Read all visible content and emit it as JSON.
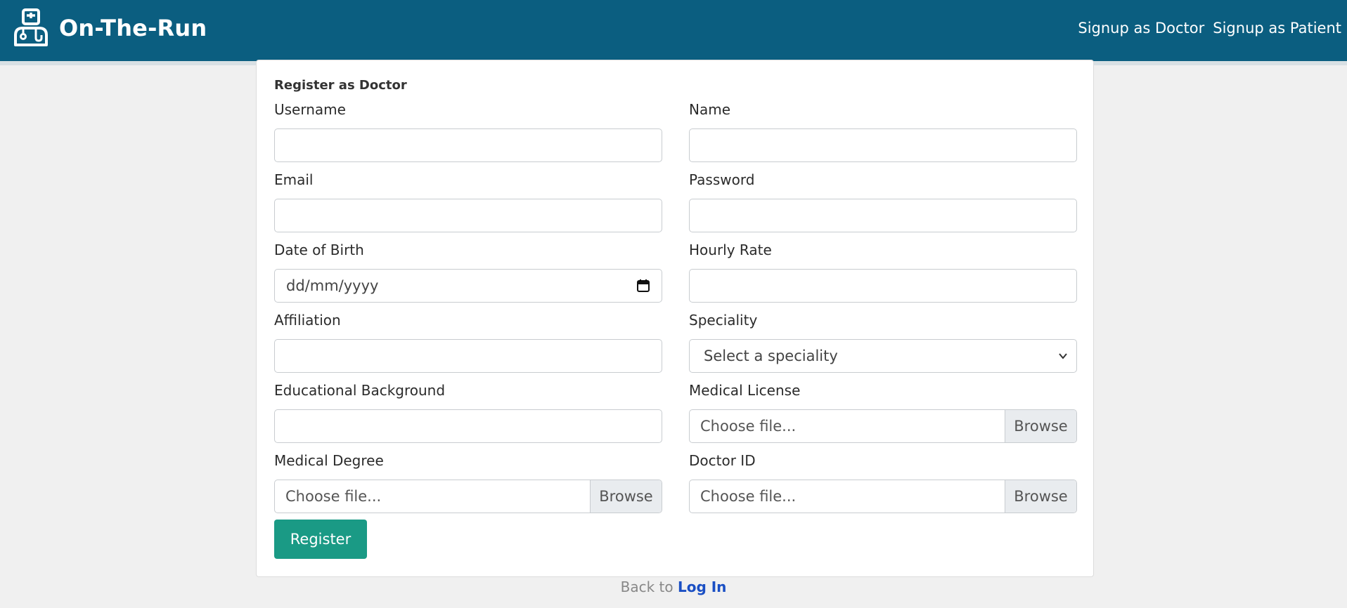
{
  "app": {
    "brand_name": "On-The-Run",
    "nav": {
      "signup_doctor": "Signup as Doctor",
      "signup_patient": "Signup as Patient"
    }
  },
  "form": {
    "title": "Register as Doctor",
    "fields": {
      "username": {
        "label": "Username",
        "value": ""
      },
      "name": {
        "label": "Name",
        "value": ""
      },
      "email": {
        "label": "Email",
        "value": ""
      },
      "password": {
        "label": "Password",
        "value": ""
      },
      "dob": {
        "label": "Date of Birth",
        "placeholder": "dd/mm/yyyy"
      },
      "hourly_rate": {
        "label": "Hourly Rate",
        "value": ""
      },
      "affiliation": {
        "label": "Affiliation",
        "value": ""
      },
      "speciality": {
        "label": "Speciality",
        "selected": "Select a speciality"
      },
      "education": {
        "label": "Educational Background",
        "value": ""
      },
      "license": {
        "label": "Medical License",
        "placeholder": "Choose file...",
        "button": "Browse"
      },
      "degree": {
        "label": "Medical Degree",
        "placeholder": "Choose file...",
        "button": "Browse"
      },
      "doctor_id": {
        "label": "Doctor ID",
        "placeholder": "Choose file...",
        "button": "Browse"
      }
    },
    "submit_label": "Register"
  },
  "footer": {
    "text": "Back to",
    "link": "Log In"
  },
  "colors": {
    "navbar": "#0b5e80",
    "primary_button": "#1a9a85",
    "link": "#1a4fc4",
    "background": "#f0f0f0"
  }
}
